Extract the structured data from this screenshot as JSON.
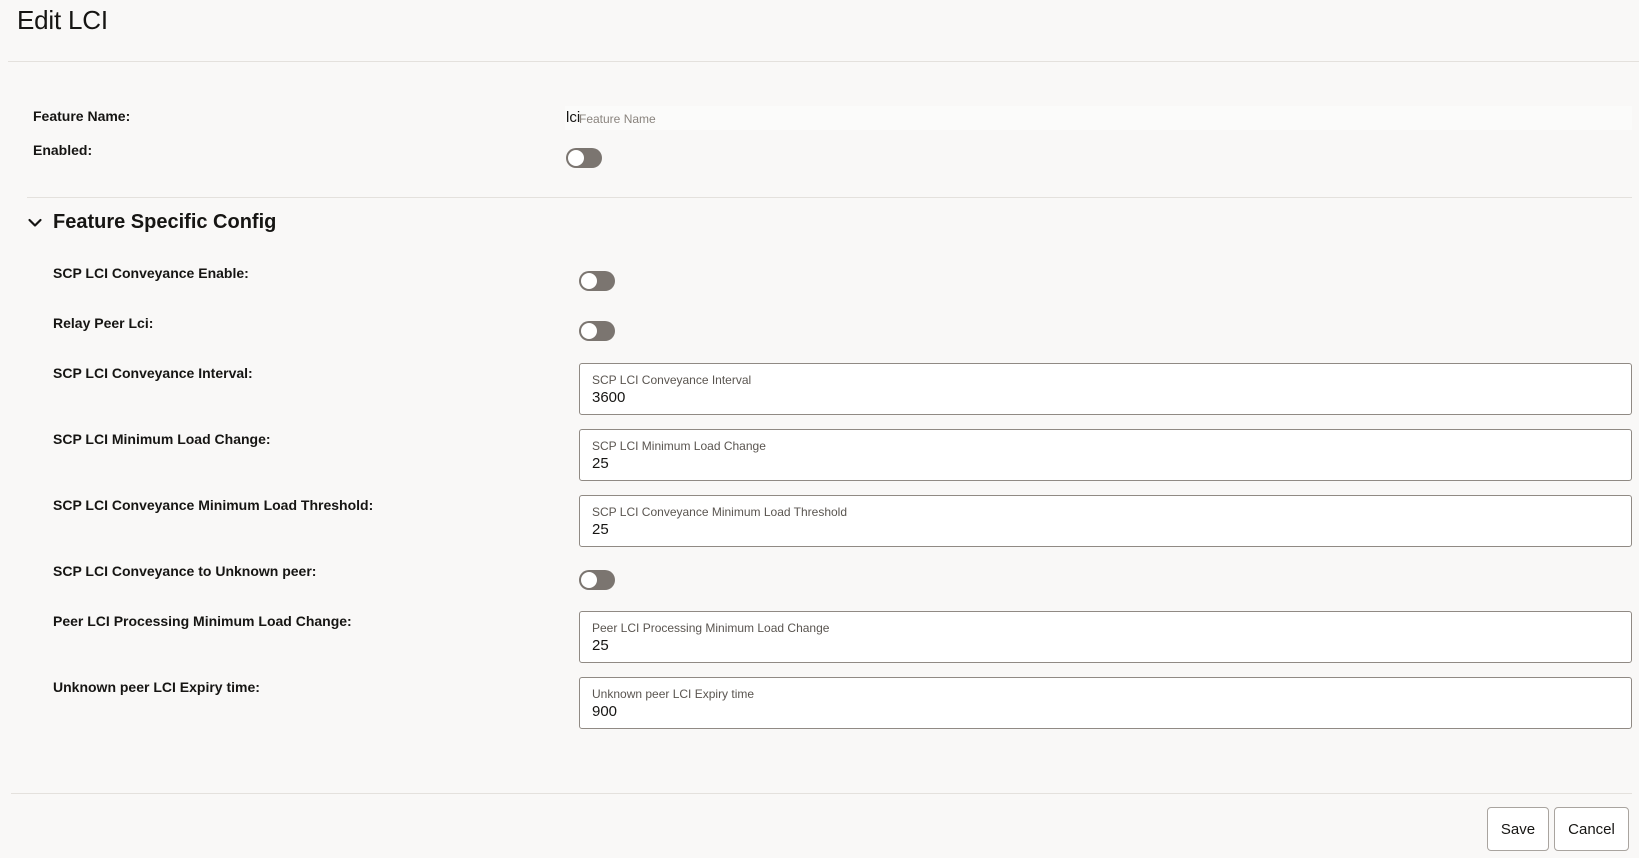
{
  "page": {
    "title": "Edit LCI"
  },
  "general": {
    "feature_name": {
      "label": "Feature Name:",
      "value": "lci",
      "placeholder": "Feature Name"
    },
    "enabled": {
      "label": "Enabled:",
      "on": false
    }
  },
  "section": {
    "title": "Feature Specific Config",
    "expanded": true,
    "scp_conveyance_enable": {
      "label": "SCP LCI Conveyance Enable:",
      "on": false
    },
    "relay_peer_lci": {
      "label": "Relay Peer Lci:",
      "on": false
    },
    "conveyance_interval": {
      "label": "SCP LCI Conveyance Interval:",
      "field_label": "SCP LCI Conveyance Interval",
      "value": "3600"
    },
    "min_load_change": {
      "label": "SCP LCI Minimum Load Change:",
      "field_label": "SCP LCI Minimum Load Change",
      "value": "25"
    },
    "min_load_threshold": {
      "label": "SCP LCI Conveyance Minimum Load Threshold:",
      "field_label": "SCP LCI Conveyance Minimum Load Threshold",
      "value": "25"
    },
    "conveyance_unknown_peer": {
      "label": "SCP LCI Conveyance to Unknown peer:",
      "on": false
    },
    "peer_min_load_change": {
      "label": "Peer LCI Processing Minimum Load Change:",
      "field_label": "Peer LCI Processing Minimum Load Change",
      "value": "25"
    },
    "unknown_peer_expiry": {
      "label": "Unknown peer LCI Expiry time:",
      "field_label": "Unknown peer LCI Expiry time",
      "value": "900"
    }
  },
  "footer": {
    "save_label": "Save",
    "cancel_label": "Cancel"
  },
  "icons": {
    "section_toggle": "chevron-down-icon"
  },
  "colors": {
    "toggle_off": "#7b7570",
    "background": "#f9f8f7",
    "border": "#908a84"
  }
}
